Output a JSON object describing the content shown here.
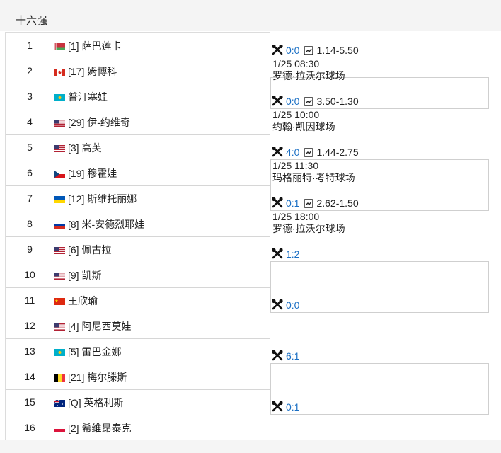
{
  "header": {
    "title": "十六强"
  },
  "players": [
    {
      "seed": "1",
      "name": "[1] 萨巴莲卡",
      "flag": "blr"
    },
    {
      "seed": "2",
      "name": "[17] 姆博科",
      "flag": "can"
    },
    {
      "seed": "3",
      "name": "普汀塞娃",
      "flag": "kaz"
    },
    {
      "seed": "4",
      "name": "[29] 伊-约维奇",
      "flag": "usa"
    },
    {
      "seed": "5",
      "name": "[3] 高芙",
      "flag": "usa"
    },
    {
      "seed": "6",
      "name": "[19] 穆霍娃",
      "flag": "cze"
    },
    {
      "seed": "7",
      "name": "[12] 斯维托丽娜",
      "flag": "ukr"
    },
    {
      "seed": "8",
      "name": "[8] 米-安德烈耶娃",
      "flag": "rus"
    },
    {
      "seed": "9",
      "name": "[6] 佩古拉",
      "flag": "usa"
    },
    {
      "seed": "10",
      "name": "[9] 凯斯",
      "flag": "usa"
    },
    {
      "seed": "11",
      "name": "王欣瑜",
      "flag": "chn"
    },
    {
      "seed": "12",
      "name": "[4] 阿尼西莫娃",
      "flag": "usa"
    },
    {
      "seed": "13",
      "name": "[5] 雷巴金娜",
      "flag": "kaz"
    },
    {
      "seed": "14",
      "name": "[21] 梅尔滕斯",
      "flag": "bel"
    },
    {
      "seed": "15",
      "name": "[Q] 英格利斯",
      "flag": "aus"
    },
    {
      "seed": "16",
      "name": "[2] 希维昂泰克",
      "flag": "pol"
    }
  ],
  "matches": [
    {
      "score": "0:0",
      "odds": "1.14-5.50",
      "time": "1/25 08:30",
      "venue": "罗德·拉沃尔球场"
    },
    {
      "score": "0:0",
      "odds": "3.50-1.30",
      "time": "1/25 10:00",
      "venue": "约翰·凯因球场"
    },
    {
      "score": "4:0",
      "odds": "1.44-2.75",
      "time": "1/25 11:30",
      "venue": "玛格丽特·考特球场"
    },
    {
      "score": "0:1",
      "odds": "2.62-1.50",
      "time": "1/25 18:00",
      "venue": "罗德·拉沃尔球场"
    },
    {
      "score": "1:2",
      "odds": "",
      "time": "",
      "venue": ""
    },
    {
      "score": "0:0",
      "odds": "",
      "time": "",
      "venue": ""
    },
    {
      "score": "6:1",
      "odds": "",
      "time": "",
      "venue": ""
    },
    {
      "score": "0:1",
      "odds": "",
      "time": "",
      "venue": ""
    }
  ],
  "icons": {
    "score_icon": "crossed-rackets-icon",
    "odds_icon": "trend-chart-icon"
  },
  "colors": {
    "score": "#1a6fc4"
  }
}
